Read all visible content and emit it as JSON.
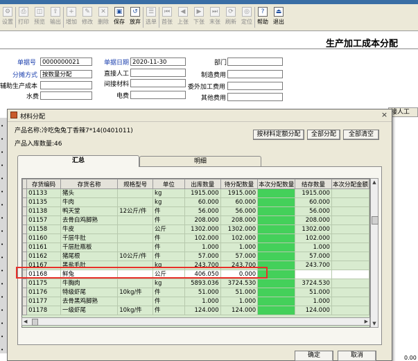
{
  "toolbar": {
    "buttons": [
      {
        "label": "设置",
        "icon": "settings-icon",
        "active": false
      },
      {
        "label": "打印",
        "icon": "print-icon",
        "active": false
      },
      {
        "label": "预览",
        "icon": "preview-icon",
        "active": false
      },
      {
        "label": "输出",
        "icon": "export-icon",
        "active": false
      },
      {
        "label": "增加",
        "icon": "add-icon",
        "active": false
      },
      {
        "label": "修改",
        "icon": "edit-icon",
        "active": false
      },
      {
        "label": "删除",
        "icon": "delete-icon",
        "active": false
      },
      {
        "label": "保存",
        "icon": "save-icon",
        "active": true
      },
      {
        "label": "放弃",
        "icon": "discard-icon",
        "active": true
      },
      {
        "label": "选单",
        "icon": "select-icon",
        "active": false
      },
      {
        "label": "首张",
        "icon": "first-icon",
        "active": false
      },
      {
        "label": "上张",
        "icon": "prev-icon",
        "active": false
      },
      {
        "label": "下张",
        "icon": "next-icon",
        "active": false
      },
      {
        "label": "末张",
        "icon": "last-icon",
        "active": false
      },
      {
        "label": "刷新",
        "icon": "refresh-icon",
        "active": false
      },
      {
        "label": "定位",
        "icon": "locate-icon",
        "active": false
      },
      {
        "label": "帮助",
        "icon": "help-icon",
        "active": true
      },
      {
        "label": "退出",
        "icon": "exit-icon",
        "active": true
      }
    ]
  },
  "header": {
    "title": "生产加工成本分配",
    "doc_no_label": "单据号",
    "doc_no": "0000000021",
    "doc_date_label": "单据日期",
    "doc_date": "2020-11-30",
    "department_label": "部门",
    "department": "",
    "alloc_method_label": "分摊方式",
    "alloc_method": "按数量分配",
    "direct_labor_label": "直接人工",
    "direct_labor": "",
    "mfg_expense_label": "制造费用",
    "mfg_expense": "",
    "aux_cost_label": "辅助生产成本",
    "aux_cost": "",
    "indirect_material_label": "间接材料",
    "indirect_material": "",
    "outsourcing_label": "委外加工费用",
    "outsourcing": "",
    "water_label": "水费",
    "water": "",
    "electricity_label": "电费",
    "electricity": "",
    "other_label": "其他费用",
    "other": ""
  },
  "background": {
    "right_header": "接人工",
    "bottom_value": "0.00"
  },
  "dialog": {
    "title": "材料分配",
    "close": "×",
    "product_name": "产品名称:冷吃兔兔丁香辣7*14(0401011)",
    "product_qty": "产品入库数量:46",
    "btn_quota": "按材料定额分配",
    "btn_alloc_all": "全部分配",
    "btn_clear_all": "全部清空",
    "tab_summary": "汇总",
    "tab_detail": "明细",
    "btn_ok": "确定",
    "btn_cancel": "取消",
    "columns": [
      "存货编码",
      "存货名称",
      "规格型号",
      "单位",
      "出库数量",
      "待分配数量",
      "本次分配数量",
      "结存数量",
      "本次分配金额"
    ],
    "rows": [
      [
        "01133",
        "猪头",
        "",
        "kg",
        "1915.000",
        "1915.000",
        "",
        "1915.000",
        ""
      ],
      [
        "01135",
        "牛肉",
        "",
        "kg",
        "60.000",
        "60.000",
        "",
        "60.000",
        ""
      ],
      [
        "01138",
        "鸭天堂",
        "12公斤/件",
        "件",
        "56.000",
        "56.000",
        "",
        "56.000",
        ""
      ],
      [
        "01157",
        "去骨白鸡脚熟",
        "",
        "件",
        "208.000",
        "208.000",
        "",
        "208.000",
        ""
      ],
      [
        "01158",
        "牛皮",
        "",
        "公斤",
        "1302.000",
        "1302.000",
        "",
        "1302.000",
        ""
      ],
      [
        "01160",
        "千层牛肚",
        "",
        "件",
        "102.000",
        "102.000",
        "",
        "102.000",
        ""
      ],
      [
        "01161",
        "千层肚瓶板",
        "",
        "件",
        "1.000",
        "1.000",
        "",
        "1.000",
        ""
      ],
      [
        "01162",
        "猪尾根",
        "10公斤/件",
        "件",
        "57.000",
        "57.000",
        "",
        "57.000",
        ""
      ],
      [
        "01167",
        "黑盐毛肚",
        "",
        "kg",
        "243.700",
        "243.700",
        "",
        "243.700",
        ""
      ],
      [
        "01168",
        "鲜兔",
        "",
        "公斤",
        "406.050",
        "0.000",
        "",
        "",
        ""
      ],
      [
        "01175",
        "牛胸肉",
        "",
        "kg",
        "5893.036",
        "3724.530",
        "",
        "3724.530",
        ""
      ],
      [
        "01176",
        "特级虾尾",
        "10kg/件",
        "件",
        "51.000",
        "51.000",
        "",
        "51.000",
        ""
      ],
      [
        "01177",
        "去骨黑鸡脚熟",
        "",
        "件",
        "1.000",
        "1.000",
        "",
        "1.000",
        ""
      ],
      [
        "01178",
        "一级虾尾",
        "10kg/件",
        "件",
        "124.000",
        "124.000",
        "",
        "124.000",
        ""
      ]
    ]
  }
}
